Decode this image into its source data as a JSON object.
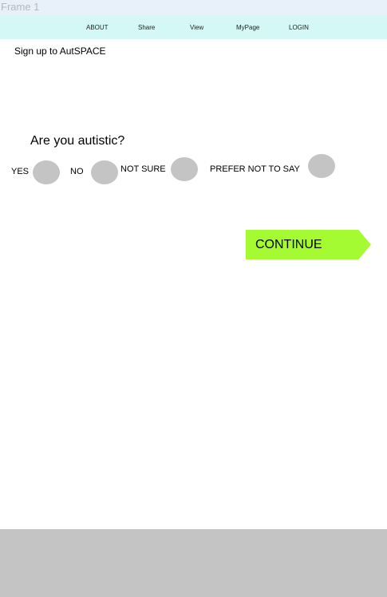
{
  "frame": {
    "label": "Frame 1"
  },
  "nav": {
    "items": [
      {
        "label": "ABOUT"
      },
      {
        "label": "Share"
      },
      {
        "label": "View"
      },
      {
        "label": "MyPage"
      },
      {
        "label": "LOGIN"
      }
    ]
  },
  "page": {
    "title": "Sign up to AutSPACE"
  },
  "question": {
    "text": "Are you autistic?",
    "options": [
      {
        "label": "YES"
      },
      {
        "label": "NO"
      },
      {
        "label": "NOT SURE"
      },
      {
        "label": "PREFER NOT TO SAY"
      }
    ]
  },
  "actions": {
    "continue_label": "CONTINUE"
  },
  "colors": {
    "nav_bg": "#d4f8f6",
    "frame_label_bg": "#e8f1fa",
    "radio": "#c4c4c4",
    "continue_bg": "#a4fb31",
    "footer_bg": "#c4c4c4"
  }
}
